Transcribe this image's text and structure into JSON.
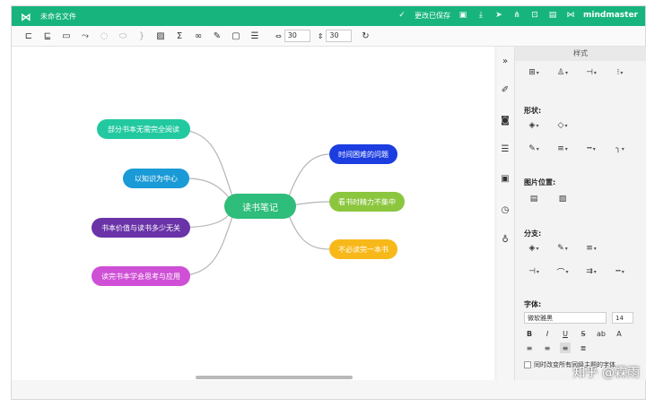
{
  "app": {
    "file_name": "未命名文件",
    "save_status": "更改已保存",
    "brand": "mindmaster"
  },
  "toolbar": {
    "width_value": "30",
    "height_value": "30"
  },
  "mindmap": {
    "center": {
      "label": "读书笔记",
      "color": "#2ebd7a"
    },
    "left": [
      {
        "label": "部分书本无需完全阅读",
        "color": "#22c9a0"
      },
      {
        "label": "以知识为中心",
        "color": "#1a9ad6"
      },
      {
        "label": "书本价值与读书多少无关",
        "color": "#6a33a8"
      },
      {
        "label": "读完书本学会思考与应用",
        "color": "#cf4fd6"
      }
    ],
    "right": [
      {
        "label": "时间困难的问题",
        "color": "#1c3de0"
      },
      {
        "label": "看书时精力不集中",
        "color": "#8cc63f"
      },
      {
        "label": "不必读完一本书",
        "color": "#f7b81a"
      }
    ],
    "link_color": "#b5b5b5"
  },
  "panel": {
    "tab_label": "样式",
    "shape_label": "形状:",
    "image_pos_label": "图片位置:",
    "branch_label": "分支:",
    "font_label": "字体:",
    "font_family": "微软雅黑",
    "font_size": "14",
    "apply_all_label": "同时改变所有同级主题的字体"
  },
  "watermark": "知乎 @霖雨"
}
